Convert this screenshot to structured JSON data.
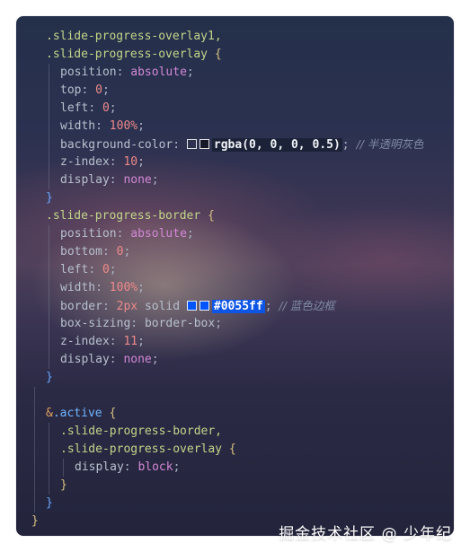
{
  "code": {
    "l1": ".slide-progress-overlay1,",
    "l2_sel": ".slide-progress-overlay",
    "l3_prop": "position",
    "l3_val": "absolute",
    "l4_prop": "top",
    "l4_val": "0",
    "l5_prop": "left",
    "l5_val": "0",
    "l6_prop": "width",
    "l6_val": "100%",
    "l7_prop": "background-color",
    "l7_val": "rgba(0, 0, 0, 0.5)",
    "l7_comment": "// 半透明灰色",
    "l8_prop": "z-index",
    "l8_val": "10",
    "l9_prop": "display",
    "l9_val": "none",
    "l11_sel": ".slide-progress-border",
    "l12_prop": "position",
    "l12_val": "absolute",
    "l13_prop": "bottom",
    "l13_val": "0",
    "l14_prop": "left",
    "l14_val": "0",
    "l15_prop": "width",
    "l15_val": "100%",
    "l16_prop": "border",
    "l16_num": "2px",
    "l16_kw": "solid",
    "l16_val": "#0055ff",
    "l16_comment": "// 蓝色边框",
    "l17_prop": "box-sizing",
    "l17_val": "border-box",
    "l18_prop": "z-index",
    "l18_val": "11",
    "l19_prop": "display",
    "l19_val": "none",
    "l22_amp": "&",
    "l22_sel": ".active",
    "l23_sel": ".slide-progress-border,",
    "l24_sel": ".slide-progress-overlay",
    "l25_prop": "display",
    "l25_val": "block"
  },
  "watermark": "掘金技术社区 @ 少年纪",
  "colors": {
    "highlight_blue": "#0055ff",
    "overlay_swatch": "rgba(0, 0, 0, 0.5)"
  }
}
